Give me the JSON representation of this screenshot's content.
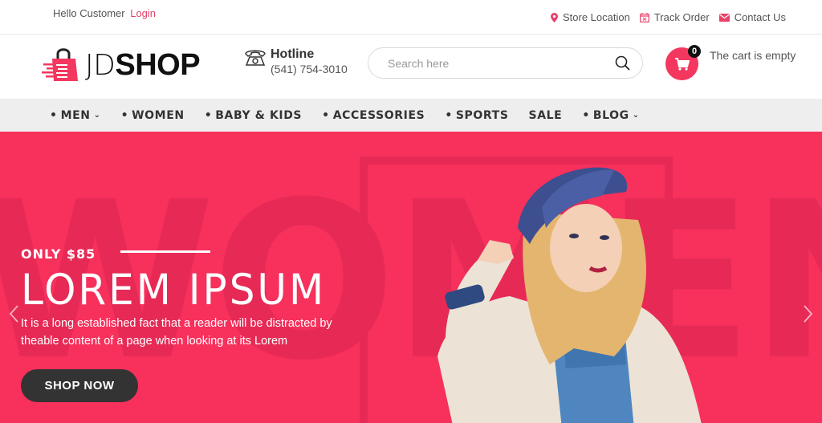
{
  "topbar": {
    "greeting": "Hello Customer",
    "login_label": "Login",
    "links": [
      {
        "label": "Store Location",
        "icon": "map-pin-icon"
      },
      {
        "label": "Track Order",
        "icon": "calendar-icon"
      },
      {
        "label": "Contact Us",
        "icon": "envelope-icon"
      }
    ]
  },
  "header": {
    "logo": {
      "jd": "JD",
      "shop": "SHOP"
    },
    "hotline": {
      "title": "Hotline",
      "number": "(541) 754-3010"
    },
    "search": {
      "placeholder": "Search here",
      "value": ""
    },
    "cart": {
      "count": "0",
      "status": "The cart is empty"
    }
  },
  "nav": {
    "items": [
      {
        "label": "MEN",
        "bullet": true,
        "dropdown": true
      },
      {
        "label": "WOMEN",
        "bullet": true,
        "dropdown": false
      },
      {
        "label": "BABY & KIDS",
        "bullet": true,
        "dropdown": false
      },
      {
        "label": "ACCESSORIES",
        "bullet": true,
        "dropdown": false
      },
      {
        "label": "SPORTS",
        "bullet": true,
        "dropdown": false
      },
      {
        "label": "SALE",
        "bullet": false,
        "dropdown": false
      },
      {
        "label": "BLOG",
        "bullet": true,
        "dropdown": true
      }
    ]
  },
  "hero": {
    "background_word": "WOMEN",
    "price_tag": "ONLY $85",
    "title": "LOREM IPSUM",
    "description": "It is a long established fact that a reader will be distracted by theable content of a page when looking at its Lorem",
    "cta_label": "SHOP NOW"
  },
  "colors": {
    "accent": "#f4375f",
    "hero_bg": "#f7305c",
    "nav_bg": "#eeeeee",
    "button_dark": "#333333"
  }
}
